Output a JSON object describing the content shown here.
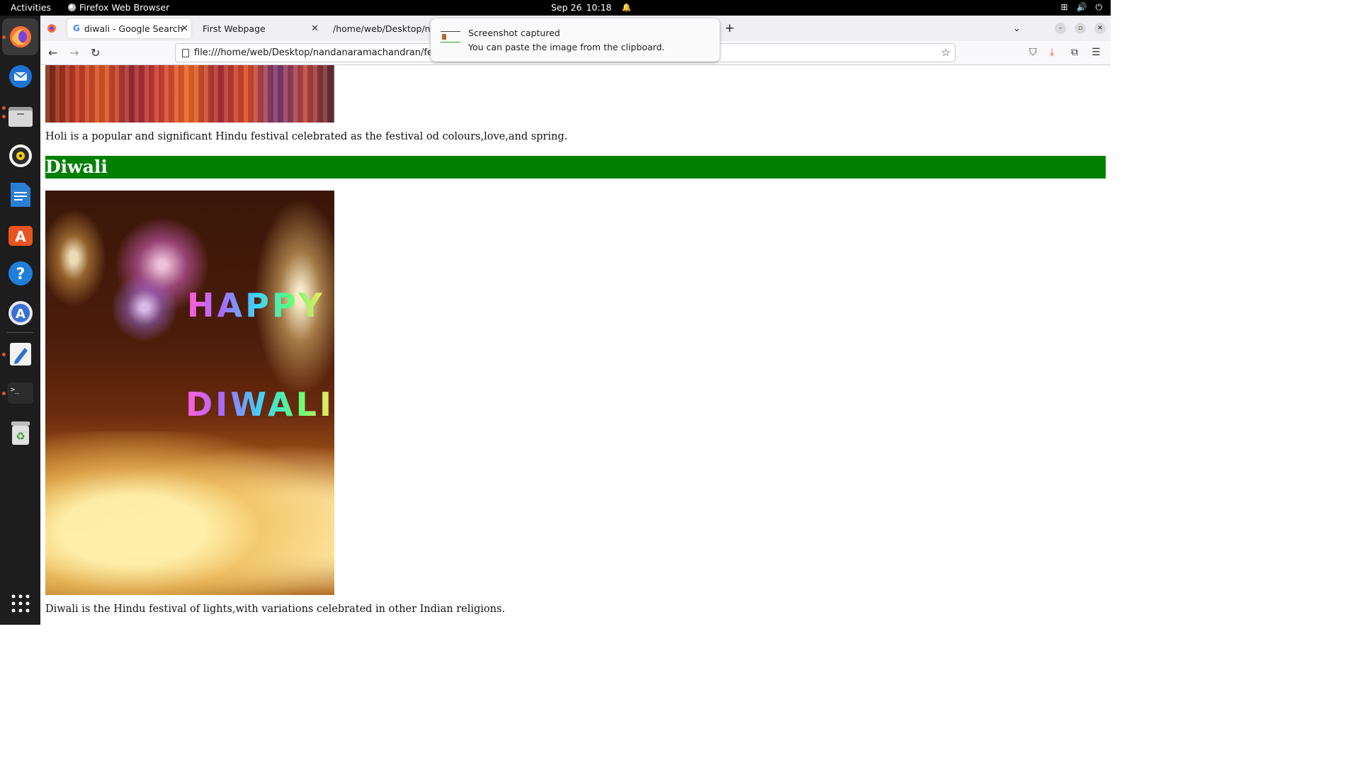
{
  "topbar": {
    "activities": "Activities",
    "app_name": "Firefox Web Browser",
    "date": "Sep 26",
    "time": "10:18"
  },
  "dock": {
    "items": [
      "firefox-icon",
      "thunderbird-icon",
      "files-icon",
      "rhythmbox-icon",
      "libreoffice-writer-icon",
      "app-center-icon",
      "help-icon",
      "software-updater-icon",
      "text-editor-icon",
      "terminal-icon",
      "trash-icon",
      "app-grid-icon"
    ]
  },
  "browser": {
    "tabs": [
      {
        "label": "diwali - Google Search",
        "icon": "google-icon"
      },
      {
        "label": "First Webpage",
        "icon": ""
      },
      {
        "label": "/home/web/Desktop/nan",
        "icon": ""
      }
    ],
    "url": "file:///home/web/Desktop/nandanaramachandran/festivals"
  },
  "notification": {
    "title": "Screenshot captured",
    "body": "You can paste the image from the clipboard."
  },
  "page": {
    "holi_text": "Holi is a popular and significant Hindu festival celebrated as the festival od colours,love,and spring.",
    "diwali_heading": "Diwali",
    "diwali_image_text": {
      "line1": "HAPPY",
      "line2": "DIWALI"
    },
    "diwali_text": "Diwali is the Hindu festival of lights,with variations celebrated in other Indian religions.",
    "heading_color": "#008000"
  },
  "colors": {
    "ubuntu_orange": "#e95420"
  }
}
